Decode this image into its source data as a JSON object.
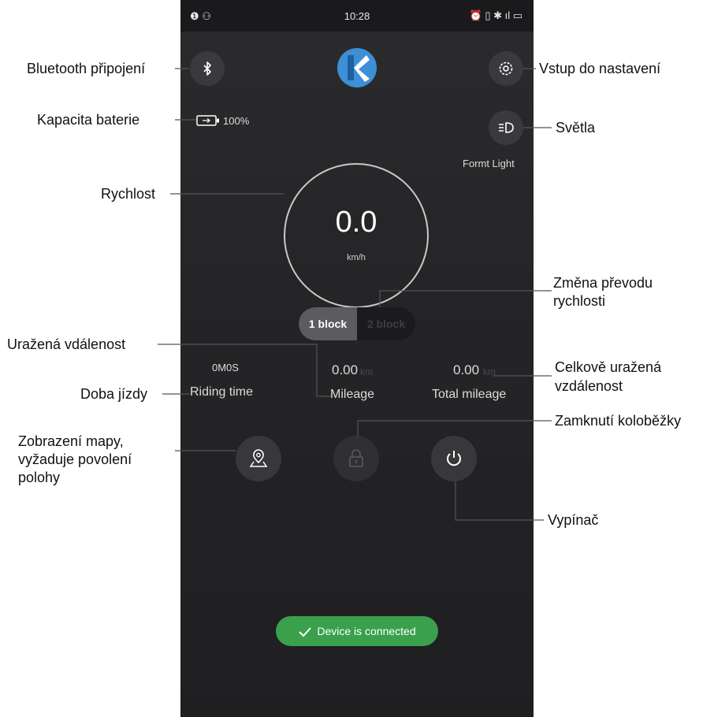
{
  "status_bar": {
    "left_icons": "❶ ⚇",
    "time": "10:28",
    "right_icons": "⏰ ▯ ✱ ıl ▭"
  },
  "battery": {
    "percent": "100%"
  },
  "light": {
    "label": "Formt Light"
  },
  "speedometer": {
    "value": "0.0",
    "unit": "km/h"
  },
  "gear_toggle": {
    "options": [
      "1 block",
      "2 block"
    ],
    "selected": "1 block"
  },
  "stats": {
    "riding_time": {
      "value": "0M0S",
      "label": "Riding time"
    },
    "mileage": {
      "value": "0.00",
      "unit": "km",
      "label": "Mileage"
    },
    "total_mileage": {
      "value": "0.00",
      "unit": "km",
      "label": "Total mileage"
    }
  },
  "toast": {
    "text": "Device is connected"
  },
  "icons": {
    "bluetooth": "bluetooth-icon",
    "logo": "brand-logo",
    "settings": "gear-icon",
    "battery": "battery-icon",
    "light": "headlight-icon",
    "map": "map-pin-icon",
    "lock": "lock-icon",
    "power": "power-icon",
    "check": "check-icon"
  },
  "annotations": {
    "bluetooth": "Bluetooth připojení",
    "settings": "Vstup do nastavení",
    "battery": "Kapacita baterie",
    "lights": "Světla",
    "speed": "Rychlost",
    "gear_line1": "Změna převodu",
    "gear_line2": "rychlosti",
    "distance": "Uražená vdálenost",
    "total_line1": "Celkově uražená",
    "total_line2": "vzdálenost",
    "riding_time": "Doba jízdy",
    "lock": "Zamknutí koloběžky",
    "map_line1": "Zobrazení mapy,",
    "map_line2": "vyžaduje povolení",
    "map_line3": "polohy",
    "power": "Vypínač"
  },
  "colors": {
    "phone_bg": "#252527",
    "toast_green": "#3aa04c",
    "logo_blue": "#3d8fd6"
  }
}
